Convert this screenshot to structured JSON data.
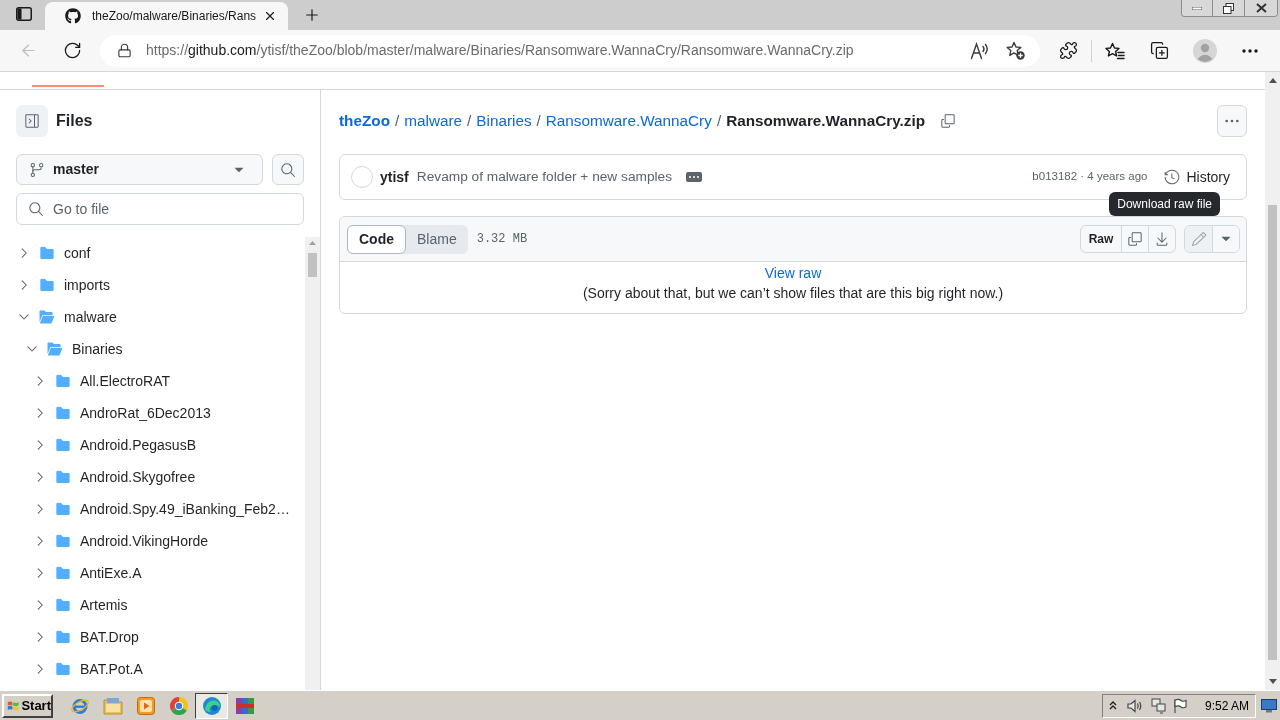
{
  "browser": {
    "tabs": [
      {
        "title": "theZoo/malware/Binaries/Rans",
        "selected": true
      }
    ],
    "back": {
      "disabled": true
    },
    "url": {
      "scheme": "https://",
      "host": "github.com",
      "path": "/ytisf/theZoo/blob/master/malware/Binaries/Ransomware.WannaCry/Ransomware.WannaCry.zip"
    }
  },
  "sidebar": {
    "title": "Files",
    "branch": "master",
    "search": {
      "placeholder": "Go to file"
    },
    "tree": [
      {
        "name": "conf",
        "expanded": false
      },
      {
        "name": "imports",
        "expanded": false
      },
      {
        "name": "malware",
        "expanded": true,
        "children": [
          {
            "name": "Binaries",
            "expanded": true,
            "children": [
              {
                "name": "All.ElectroRAT",
                "expanded": false
              },
              {
                "name": "AndroRat_6Dec2013",
                "expanded": false
              },
              {
                "name": "Android.PegasusB",
                "expanded": false
              },
              {
                "name": "Android.Skygofree",
                "expanded": false
              },
              {
                "name": "Android.Spy.49_iBanking_Feb2…",
                "expanded": false
              },
              {
                "name": "Android.VikingHorde",
                "expanded": false
              },
              {
                "name": "AntiExe.A",
                "expanded": false
              },
              {
                "name": "Artemis",
                "expanded": false
              },
              {
                "name": "BAT.Drop",
                "expanded": false
              },
              {
                "name": "BAT.Pot.A",
                "expanded": false
              }
            ]
          }
        ]
      }
    ]
  },
  "file_view": {
    "breadcrumb": [
      {
        "kind": "repo",
        "label": "theZoo"
      },
      {
        "kind": "separator",
        "label": "/"
      },
      {
        "kind": "folder",
        "label": "malware"
      },
      {
        "kind": "separator",
        "label": "/"
      },
      {
        "kind": "folder",
        "label": "Binaries"
      },
      {
        "kind": "separator",
        "label": "/"
      },
      {
        "kind": "folder",
        "label": "Ransomware.WannaCry"
      },
      {
        "kind": "separator",
        "label": "/"
      },
      {
        "kind": "file",
        "label": "Ransomware.WannaCry.zip"
      }
    ],
    "commit": {
      "author": "ytisf",
      "message": "Revamp of malware folder + new samples",
      "meta": "b013182 · 4 years ago",
      "history": "History"
    },
    "tabs": [
      {
        "label": "Code",
        "selected": true
      },
      {
        "label": "Blame",
        "selected": false
      }
    ],
    "size": "3.32 MB",
    "raw": "Raw",
    "edit": {
      "disabled": true
    },
    "tooltip": "Download raw file",
    "body": {
      "link": "View raw",
      "message": "(Sorry about that, but we can’t show files that are this big right now.)"
    }
  },
  "taskbar": {
    "start": "Start",
    "apps": [
      {
        "kind": "ie",
        "selected": false
      },
      {
        "kind": "explorer",
        "selected": false
      },
      {
        "kind": "media",
        "selected": false
      },
      {
        "kind": "chrome",
        "selected": false
      },
      {
        "kind": "edge",
        "selected": true
      },
      {
        "kind": "archiver",
        "selected": false
      }
    ],
    "clock": "9:52 AM"
  }
}
